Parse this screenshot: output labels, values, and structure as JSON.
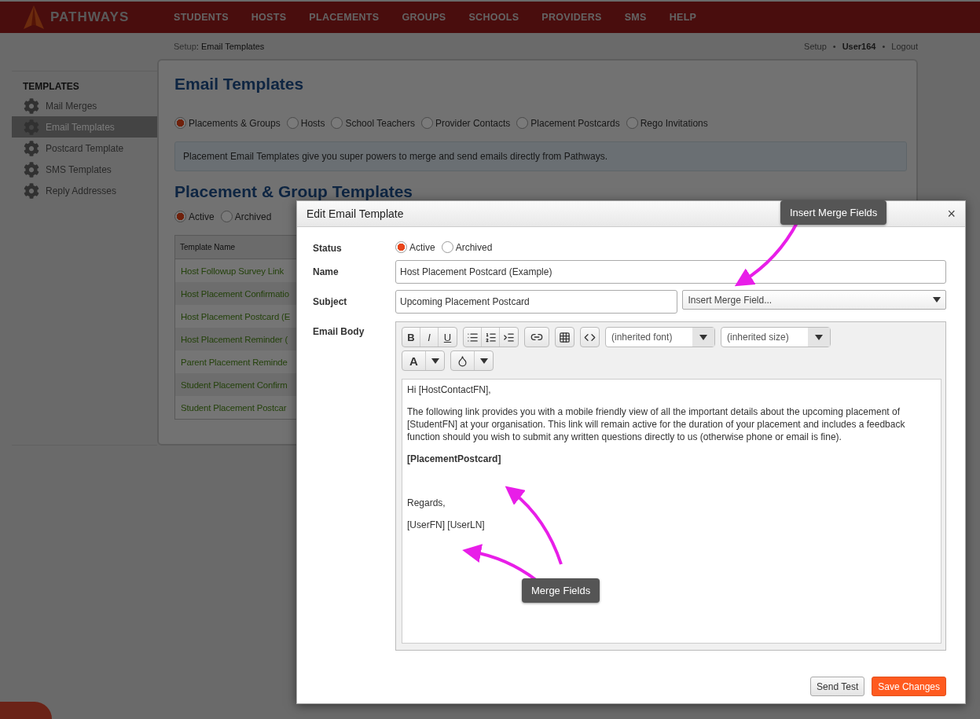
{
  "nav": {
    "logo": "PATHWAYS",
    "items": [
      "STUDENTS",
      "HOSTS",
      "PLACEMENTS",
      "GROUPS",
      "SCHOOLS",
      "PROVIDERS",
      "SMS",
      "HELP"
    ]
  },
  "breadcrumb": {
    "section": "Setup",
    "separator": ":",
    "page": "Email Templates"
  },
  "user_menu": {
    "setup": "Setup",
    "separator": "•",
    "user": "User164",
    "logout": "Logout"
  },
  "sidebar": {
    "heading": "TEMPLATES",
    "items": [
      {
        "label": "Mail Merges",
        "selected": false
      },
      {
        "label": "Email Templates",
        "selected": true
      },
      {
        "label": "Postcard Template",
        "selected": false
      },
      {
        "label": "SMS Templates",
        "selected": false
      },
      {
        "label": "Reply Addresses",
        "selected": false
      }
    ]
  },
  "page": {
    "title": "Email Templates",
    "template_types": [
      {
        "label": "Placements & Groups",
        "selected": true
      },
      {
        "label": "Hosts",
        "selected": false
      },
      {
        "label": "School Teachers",
        "selected": false
      },
      {
        "label": "Provider Contacts",
        "selected": false
      },
      {
        "label": "Placement Postcards",
        "selected": false
      },
      {
        "label": "Rego Invitations",
        "selected": false
      }
    ],
    "info": "Placement Email Templates give you super powers to merge and send emails directly from Pathways.",
    "section_title": "Placement & Group Templates",
    "status_filter": [
      {
        "label": "Active",
        "selected": true
      },
      {
        "label": "Archived",
        "selected": false
      }
    ],
    "table": {
      "columns": [
        "Template Name"
      ],
      "rows": [
        "Host Followup Survey Link",
        "Host Placement Confirmatio",
        "Host Placement Postcard (E",
        "Host Placement Reminder (",
        "Parent Placement Reminde",
        "Student Placement Confirm",
        "Student Placement Postcar"
      ]
    }
  },
  "dialog": {
    "title": "Edit Email Template",
    "close": "×",
    "status": {
      "label": "Status",
      "options": [
        {
          "label": "Active",
          "selected": true
        },
        {
          "label": "Archived",
          "selected": false
        }
      ]
    },
    "name": {
      "label": "Name",
      "value": "Host Placement Postcard (Example)"
    },
    "subject": {
      "label": "Subject",
      "value": "Upcoming Placement Postcard",
      "merge_placeholder": "Insert Merge Field..."
    },
    "body": {
      "label": "Email Body",
      "toolbar": {
        "format": [
          "B",
          "I",
          "U"
        ],
        "font": "(inherited font)",
        "size": "(inherited size)",
        "text_color": "A"
      },
      "paragraphs": [
        {
          "kind": "text",
          "text": "Hi [HostContactFN],"
        },
        {
          "kind": "text",
          "text": "The following link provides you with a mobile friendly view of all the important details about the upcoming placement of [StudentFN] at your organisation. This link will remain active for the duration of your placement and includes a feedback function should you wish to submit any written questions directly to us (otherwise phone or email is fine)."
        },
        {
          "kind": "bold",
          "text": "[PlacementPostcard]"
        },
        {
          "kind": "blank"
        },
        {
          "kind": "text",
          "text": "Regards,"
        },
        {
          "kind": "text",
          "text": "[UserFN] [UserLN]"
        }
      ]
    },
    "buttons": [
      {
        "label": "Send Test",
        "kind": "secondary"
      },
      {
        "label": "Save Changes",
        "kind": "primary"
      }
    ]
  },
  "annotations": [
    {
      "label": "Insert Merge Fields"
    },
    {
      "label": "Merge Fields"
    }
  ]
}
